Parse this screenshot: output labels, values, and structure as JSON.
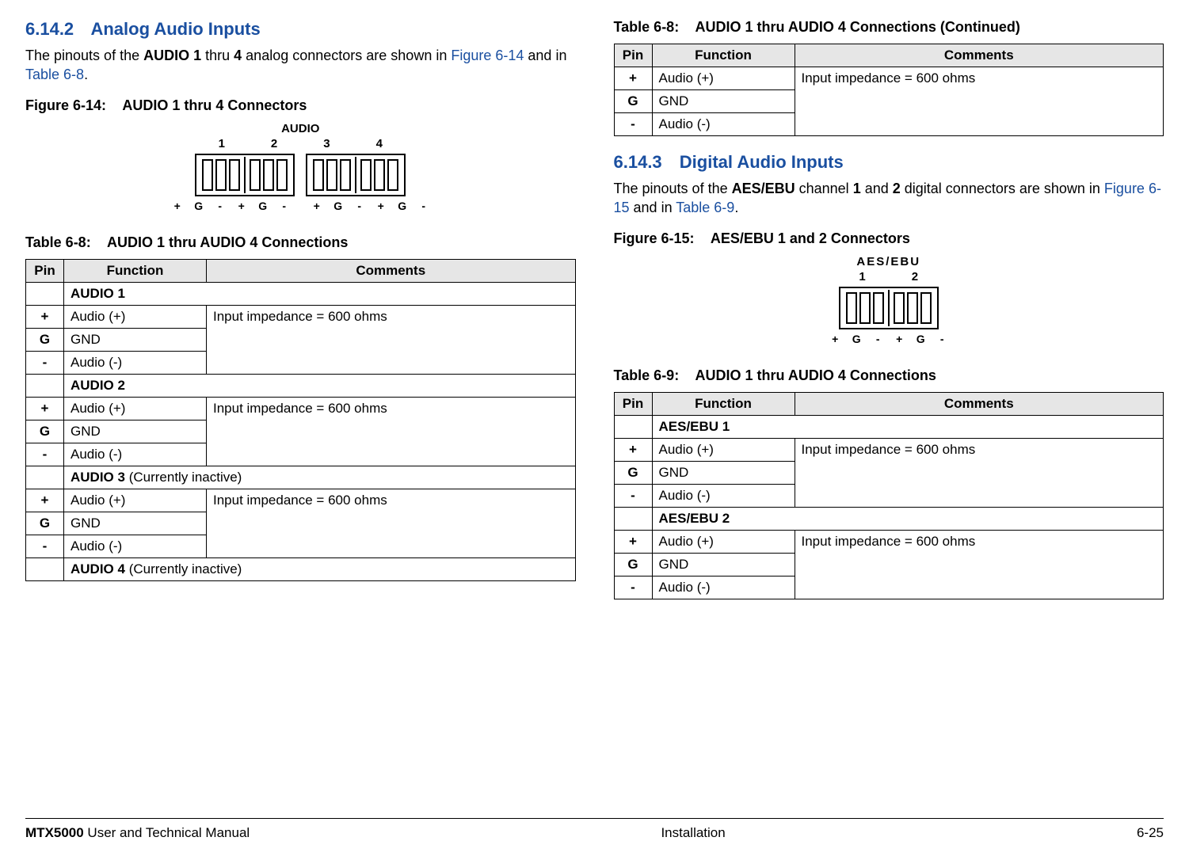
{
  "left": {
    "sec_num": "6.14.2",
    "sec_title": "Analog Audio Inputs",
    "para_1": "The pinouts of the ",
    "para_2": "AUDIO 1",
    "para_3": " thru ",
    "para_4": "4",
    "para_5": " analog connectors are shown in ",
    "para_link1": "Figure 6-14",
    "para_6": " and in ",
    "para_link2": "Table 6-8",
    "para_7": ".",
    "fig_lbl": "Figure 6-14:",
    "fig_title": "AUDIO 1 thru 4 Connectors",
    "conn_title": "AUDIO",
    "conn_nums": [
      "1",
      "2",
      "3",
      "4"
    ],
    "pin_lbls": [
      "+",
      "G",
      "-",
      "+",
      "G",
      "-",
      "",
      "+",
      "G",
      "-",
      "+",
      "G",
      "-"
    ],
    "tab_lbl": "Table 6-8:",
    "tab_title": "AUDIO 1 thru AUDIO 4 Connections",
    "th": [
      "Pin",
      "Function",
      "Comments"
    ],
    "rows": [
      {
        "group": "AUDIO 1"
      },
      {
        "pin": "+",
        "func": "Audio (+)",
        "comment": "Input impedance = 600 ohms",
        "rowspan": 3
      },
      {
        "pin": "G",
        "func": "GND"
      },
      {
        "pin": "-",
        "func": "Audio (-)"
      },
      {
        "group": "AUDIO 2"
      },
      {
        "pin": "+",
        "func": "Audio (+)",
        "comment": "Input impedance = 600 ohms",
        "rowspan": 3
      },
      {
        "pin": "G",
        "func": "GND"
      },
      {
        "pin": "-",
        "func": "Audio (-)"
      },
      {
        "group_a": "AUDIO 3",
        "group_b": " (Currently inactive)"
      },
      {
        "pin": "+",
        "func": "Audio (+)",
        "comment": "Input impedance = 600 ohms",
        "rowspan": 3
      },
      {
        "pin": "G",
        "func": "GND"
      },
      {
        "pin": "-",
        "func": "Audio (-)"
      },
      {
        "group_a": "AUDIO 4",
        "group_b": " (Currently inactive)"
      }
    ]
  },
  "right": {
    "cont_lbl": "Table 6-8:",
    "cont_title": "AUDIO 1 thru AUDIO 4 Connections (Continued)",
    "th": [
      "Pin",
      "Function",
      "Comments"
    ],
    "cont_rows": [
      {
        "pin": "+",
        "func": "Audio (+)",
        "comment": "Input impedance = 600 ohms",
        "rowspan": 3
      },
      {
        "pin": "G",
        "func": "GND"
      },
      {
        "pin": "-",
        "func": "Audio (-)"
      }
    ],
    "sec_num": "6.14.3",
    "sec_title": "Digital Audio Inputs",
    "para_1": "The pinouts of the ",
    "para_2": "AES/EBU",
    "para_3": " channel  ",
    "para_4": "1",
    "para_5": " and ",
    "para_6": "2",
    "para_7": " digital connectors are shown in ",
    "para_link1": "Figure 6-15",
    "para_8": " and in ",
    "para_link2": "Table 6-9",
    "para_9": ".",
    "fig_lbl": "Figure 6-15:",
    "fig_title": "AES/EBU 1 and 2 Connectors",
    "conn_title": "AES/EBU",
    "conn_nums": [
      "1",
      "2"
    ],
    "pin_lbls": [
      "+",
      "G",
      "-",
      "+",
      "G",
      "-"
    ],
    "tab_lbl": "Table 6-9:",
    "tab_title": "AUDIO 1 thru AUDIO 4 Connections",
    "th2": [
      "Pin",
      "Function",
      "Comments"
    ],
    "rows": [
      {
        "group": "AES/EBU 1"
      },
      {
        "pin": "+",
        "func": "Audio (+)",
        "comment": "Input impedance = 600 ohms",
        "rowspan": 3
      },
      {
        "pin": "G",
        "func": "GND"
      },
      {
        "pin": "-",
        "func": "Audio (-)"
      },
      {
        "group": "AES/EBU 2"
      },
      {
        "pin": "+",
        "func": "Audio (+)",
        "comment": "Input impedance = 600 ohms",
        "rowspan": 3
      },
      {
        "pin": "G",
        "func": "GND"
      },
      {
        "pin": "-",
        "func": "Audio (-)"
      }
    ]
  },
  "footer": {
    "left_bold": "MTX5000",
    "left_rest": " User and Technical Manual",
    "center": "Installation",
    "right": "6-25"
  }
}
